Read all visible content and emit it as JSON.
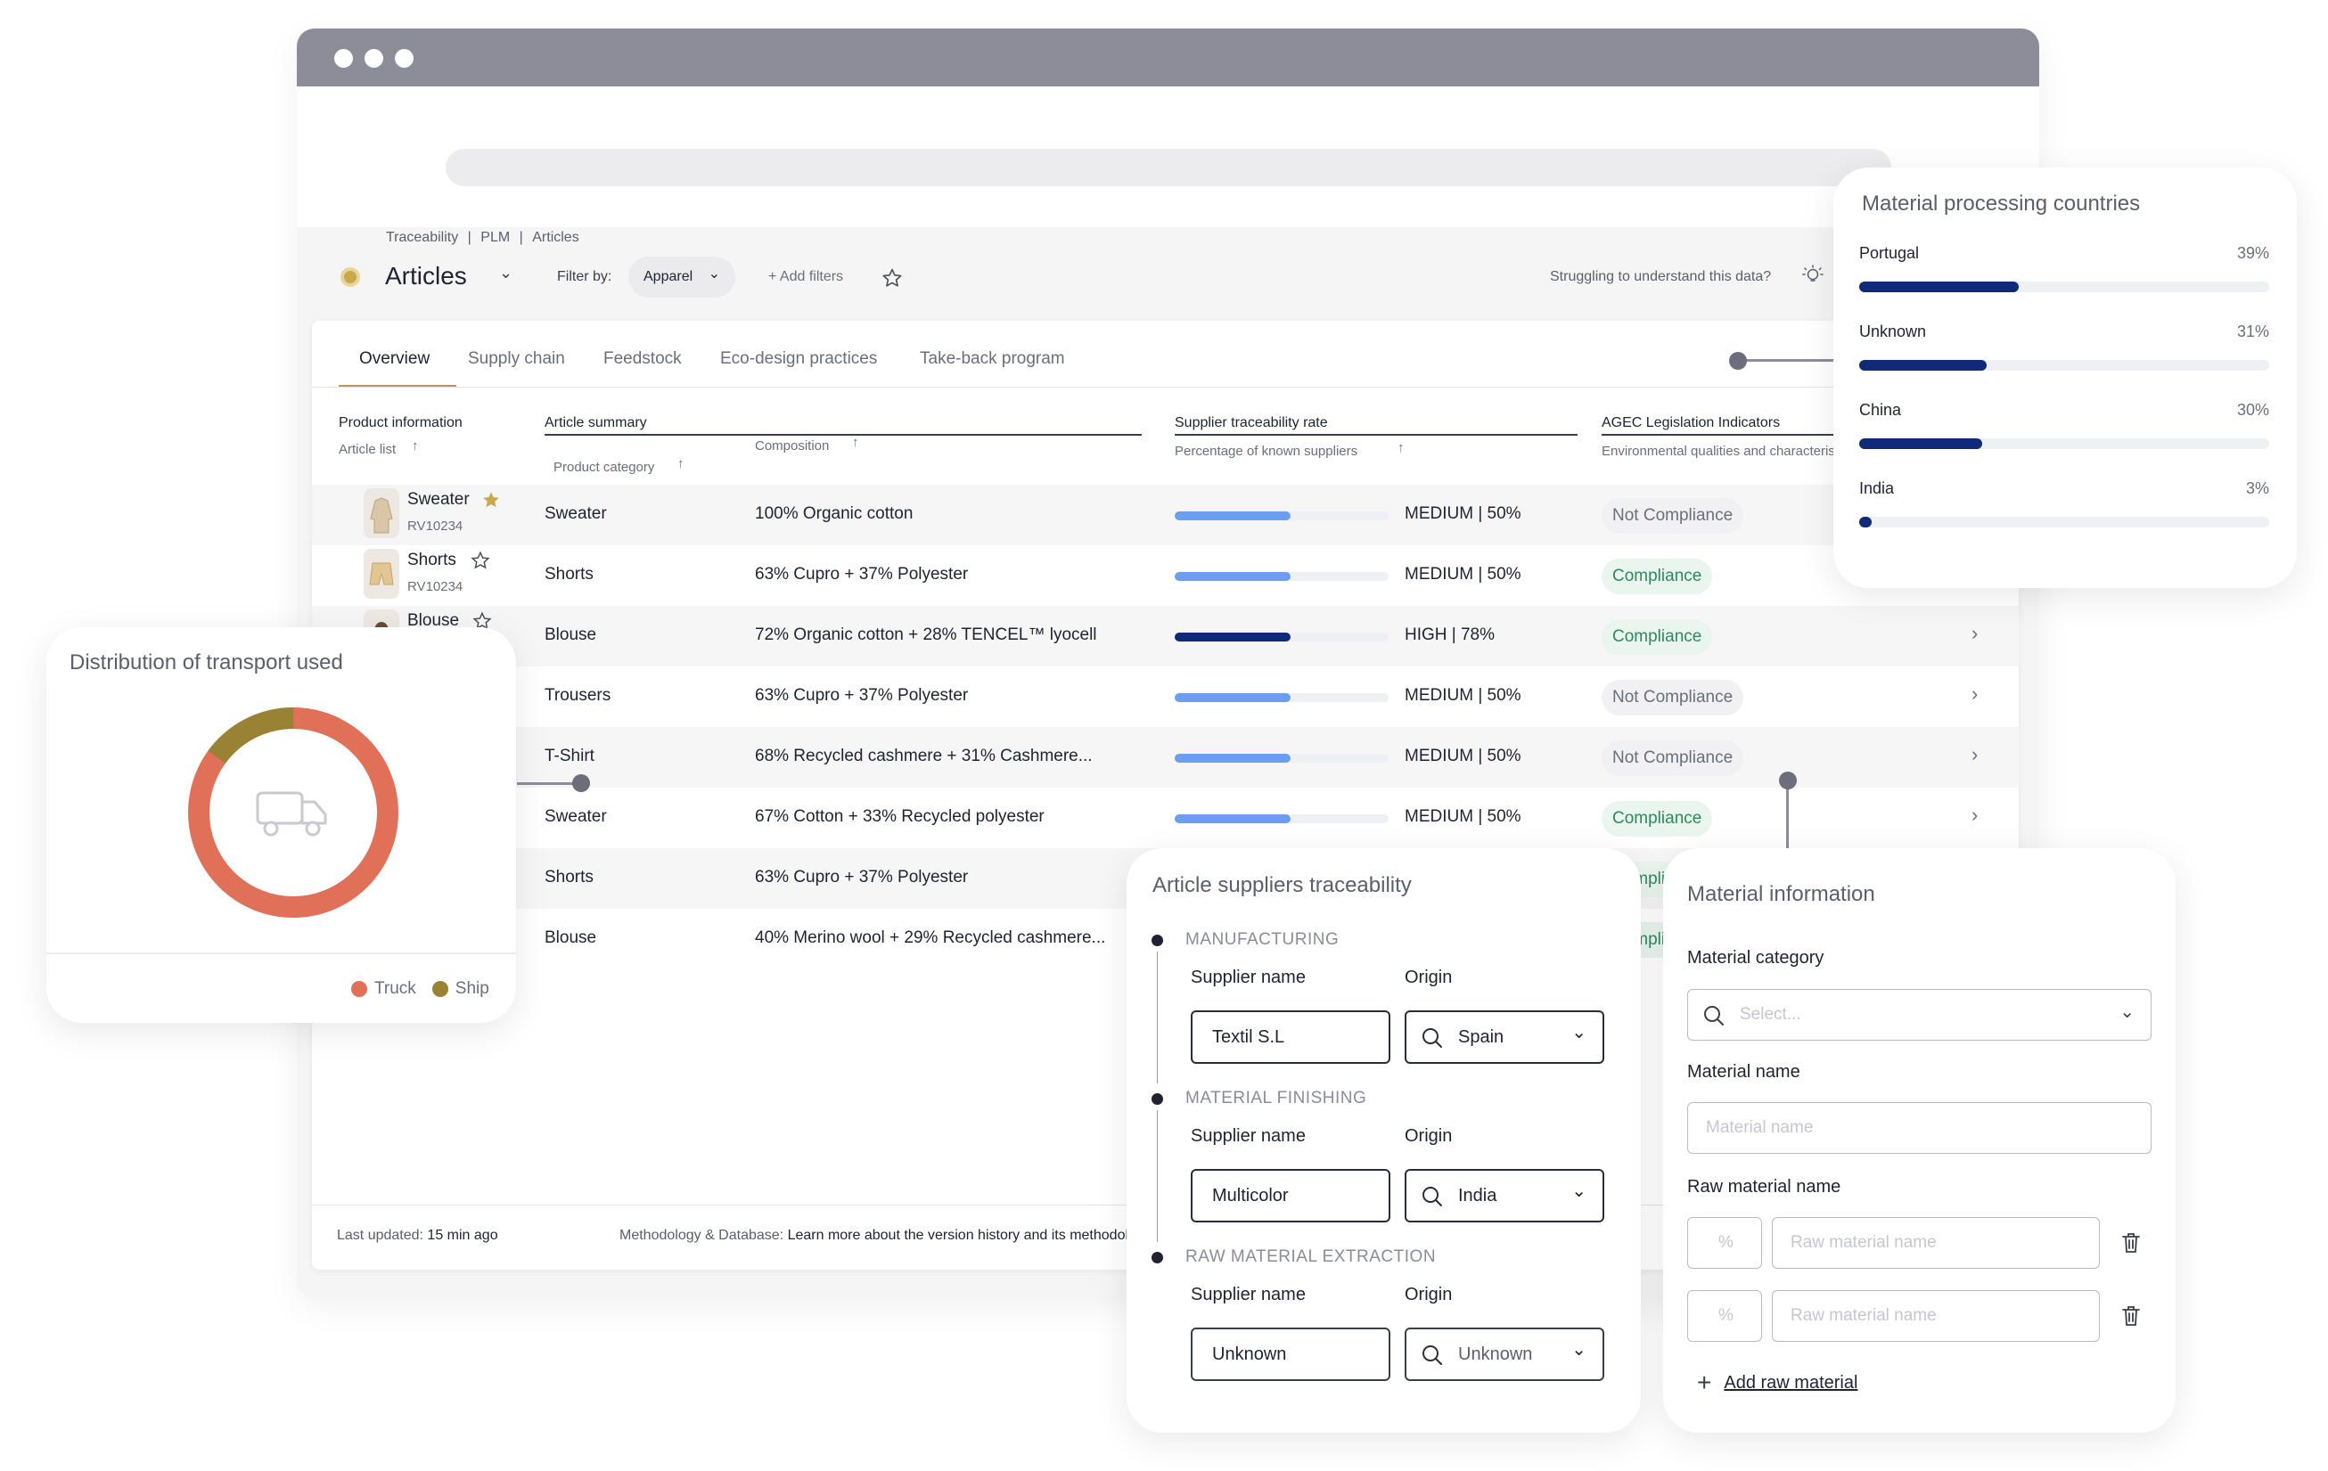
{
  "breadcrumb": [
    "Traceability",
    "PLM",
    "Articles"
  ],
  "header": {
    "title": "Articles",
    "filter_label": "Filter by:",
    "filter_value": "Apparel",
    "add_filters": "+ Add filters",
    "help_text": "Struggling to understand this data?"
  },
  "tabs": [
    "Overview",
    "Supply chain",
    "Feedstock",
    "Eco-design practices",
    "Take-back program"
  ],
  "columns": {
    "product_info": "Product information",
    "article_list": "Article list",
    "article_summary": "Article summary",
    "composition": "Composition",
    "product_category": "Product category",
    "supplier_rate": "Supplier traceability rate",
    "supplier_rate_sub": "Percentage of known suppliers",
    "agec": "AGEC Legislation Indicators",
    "agec_sub": "Environmental qualities and characteristics"
  },
  "products": [
    {
      "name": "Sweater",
      "code": "RV10234"
    },
    {
      "name": "Shorts",
      "code": "RV10234"
    },
    {
      "name": "Blouse",
      "code": ""
    }
  ],
  "rows": [
    {
      "category": "Sweater",
      "composition": "100% Organic cotton",
      "rate_text": "MEDIUM | 50%",
      "rate": 0.5,
      "level": "medium",
      "agec": "Not Compliance",
      "ok": false
    },
    {
      "category": "Shorts",
      "composition": "63% Cupro + 37% Polyester",
      "rate_text": "MEDIUM | 50%",
      "rate": 0.5,
      "level": "medium",
      "agec": "Compliance",
      "ok": true
    },
    {
      "category": "Blouse",
      "composition": "72% Organic cotton + 28% TENCEL™ lyocell",
      "rate_text": "HIGH | 78%",
      "rate": 0.78,
      "level": "high",
      "agec": "Compliance",
      "ok": true
    },
    {
      "category": "Trousers",
      "composition": "63% Cupro + 37% Polyester",
      "rate_text": "MEDIUM | 50%",
      "rate": 0.5,
      "level": "medium",
      "agec": "Not Compliance",
      "ok": false
    },
    {
      "category": "T-Shirt",
      "composition": "68% Recycled cashmere + 31% Cashmere...",
      "rate_text": "MEDIUM | 50%",
      "rate": 0.5,
      "level": "medium",
      "agec": "Not Compliance",
      "ok": false
    },
    {
      "category": "Sweater",
      "composition": "67% Cotton + 33% Recycled polyester",
      "rate_text": "MEDIUM | 50%",
      "rate": 0.5,
      "level": "medium",
      "agec": "Compliance",
      "ok": true
    },
    {
      "category": "Shorts",
      "composition": "63% Cupro + 37% Polyester",
      "rate_text": "",
      "rate": null,
      "level": "",
      "agec": "Compliance",
      "ok": true
    },
    {
      "category": "Blouse",
      "composition": "40% Merino wool + 29% Recycled cashmere...",
      "rate_text": "",
      "rate": null,
      "level": "",
      "agec": "Compliance",
      "ok": true
    }
  ],
  "footer": {
    "updated_label": "Last updated:",
    "updated_value": "15 min ago",
    "methodology_label": "Methodology & Database:",
    "methodology_value": "Learn more about the version history and its methodology"
  },
  "countries_card": {
    "title": "Material processing countries",
    "items": [
      {
        "name": "Portugal",
        "pct_text": "39%",
        "pct": 0.39
      },
      {
        "name": "Unknown",
        "pct_text": "31%",
        "pct": 0.31
      },
      {
        "name": "China",
        "pct_text": "30%",
        "pct": 0.3
      },
      {
        "name": "India",
        "pct_text": "3%",
        "pct": 0.03
      }
    ]
  },
  "transport_card": {
    "title": "Distribution of transport used",
    "legend": [
      {
        "name": "Truck",
        "color": "#e07058",
        "share": 0.85
      },
      {
        "name": "Ship",
        "color": "#9a8235",
        "share": 0.15
      }
    ]
  },
  "suppliers_card": {
    "title": "Article suppliers traceability",
    "supplier_label": "Supplier name",
    "origin_label": "Origin",
    "stages": [
      {
        "name": "MANUFACTURING",
        "supplier": "Textil S.L",
        "origin": "Spain"
      },
      {
        "name": "MATERIAL FINISHING",
        "supplier": "Multicolor",
        "origin": "India"
      },
      {
        "name": "RAW MATERIAL EXTRACTION",
        "supplier": "Unknown",
        "origin": "Unknown"
      }
    ]
  },
  "material_card": {
    "title": "Material information",
    "category_label": "Material category",
    "category_placeholder": "Select...",
    "name_label": "Material name",
    "name_placeholder": "Material name",
    "raw_label": "Raw material name",
    "pct_placeholder": "%",
    "raw_placeholder": "Raw material name",
    "add_label": "Add raw material"
  },
  "colors": {
    "accent": "#b59a55",
    "bar_medium": "#6a9ef0",
    "bar_high": "#0e2a78",
    "compliance": "#2c8a5a"
  }
}
